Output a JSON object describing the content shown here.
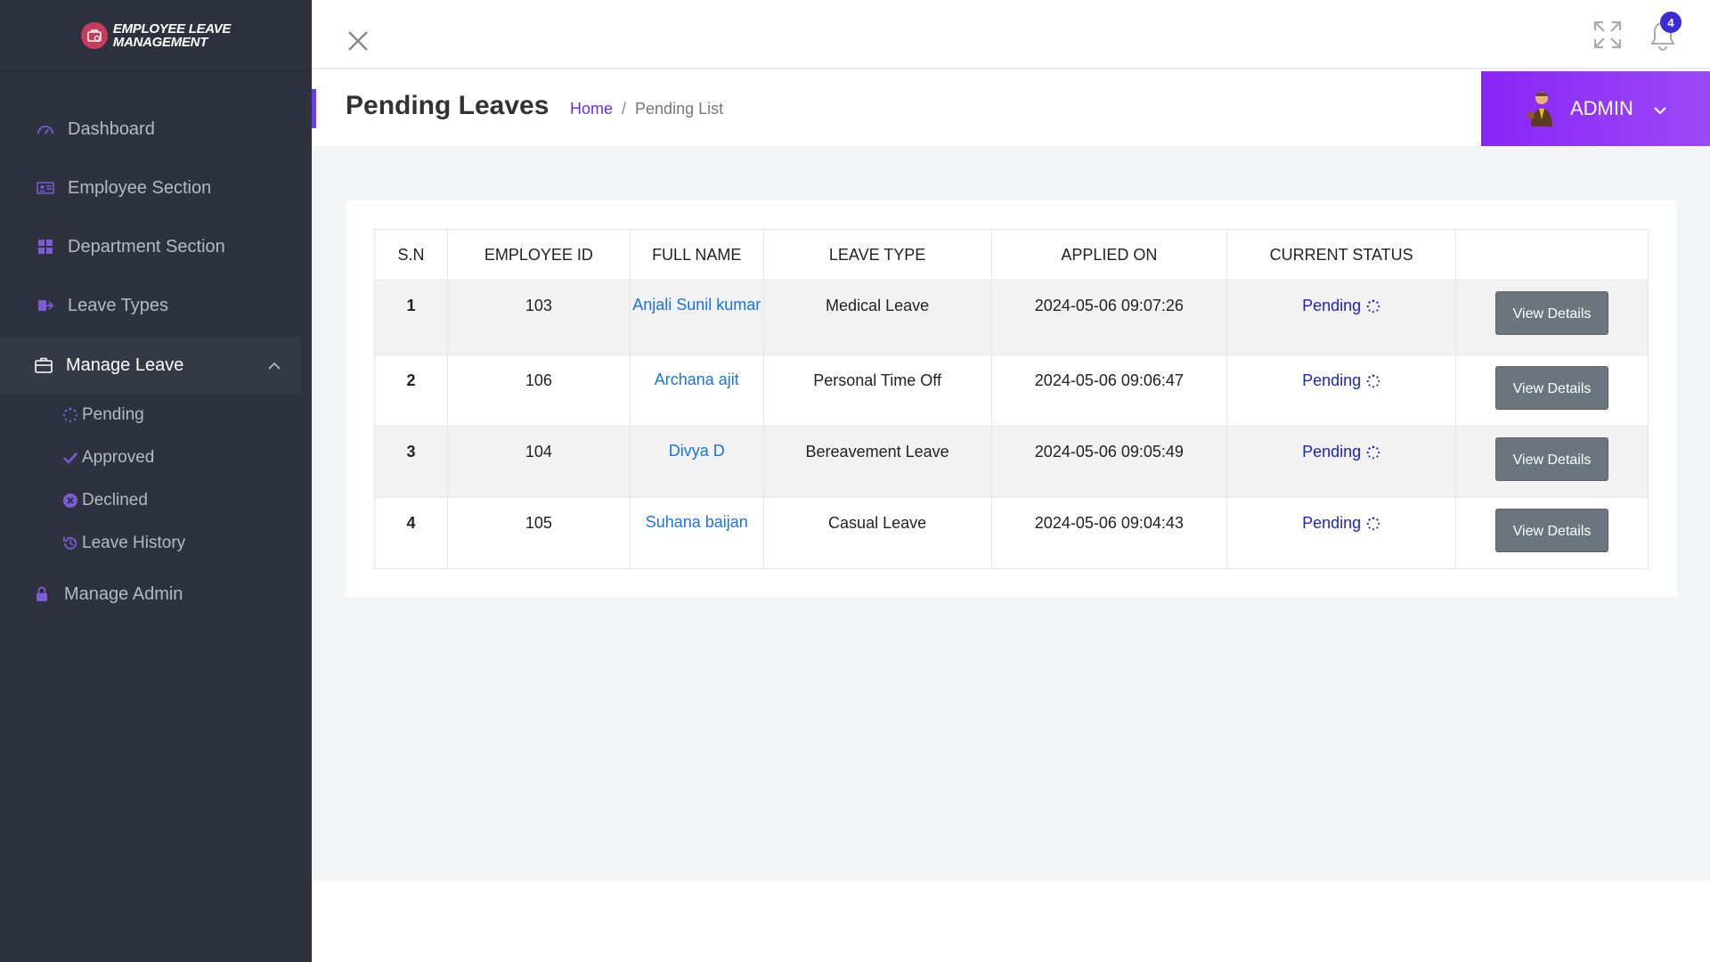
{
  "brand": {
    "line1": "Employee Leave",
    "line2": "Management",
    "logo_icon": "briefcase-icon",
    "logo_color": "#c73b5c"
  },
  "sidebar": {
    "items": [
      {
        "label": "Dashboard",
        "icon": "dashboard-gauge-icon"
      },
      {
        "label": "Employee Section",
        "icon": "id-card-icon"
      },
      {
        "label": "Department Section",
        "icon": "grid-icon"
      },
      {
        "label": "Leave Types",
        "icon": "sign-out-icon"
      },
      {
        "label": "Manage Leave",
        "icon": "briefcase-icon",
        "active": true,
        "expanded": true
      },
      {
        "label": "Manage Admin",
        "icon": "lock-icon"
      }
    ],
    "submenu": [
      {
        "label": "Pending",
        "icon": "spinner-icon"
      },
      {
        "label": "Approved",
        "icon": "check-icon"
      },
      {
        "label": "Declined",
        "icon": "times-circle-icon"
      },
      {
        "label": "Leave History",
        "icon": "history-icon"
      }
    ]
  },
  "topbar": {
    "notification_count": "4"
  },
  "header": {
    "title": "Pending Leaves",
    "breadcrumb_home": "Home",
    "breadcrumb_sep": "/",
    "breadcrumb_current": "Pending List"
  },
  "admin": {
    "label": "ADMIN"
  },
  "table": {
    "columns": [
      "S.N",
      "EMPLOYEE ID",
      "FULL NAME",
      "LEAVE TYPE",
      "APPLIED ON",
      "CURRENT STATUS",
      ""
    ],
    "rows": [
      {
        "sn": "1",
        "emp_id": "103",
        "name": "Anjali Sunil kumar",
        "type": "Medical Leave",
        "applied": "2024-05-06 09:07:26",
        "status": "Pending",
        "action": "View Details"
      },
      {
        "sn": "2",
        "emp_id": "106",
        "name": "Archana ajit",
        "type": "Personal Time Off",
        "applied": "2024-05-06 09:06:47",
        "status": "Pending",
        "action": "View Details"
      },
      {
        "sn": "3",
        "emp_id": "104",
        "name": "Divya D",
        "type": "Bereavement Leave",
        "applied": "2024-05-06 09:05:49",
        "status": "Pending",
        "action": "View Details"
      },
      {
        "sn": "4",
        "emp_id": "105",
        "name": "Suhana baijan",
        "type": "Casual Leave",
        "applied": "2024-05-06 09:04:43",
        "status": "Pending",
        "action": "View Details"
      }
    ]
  },
  "colors": {
    "sidebar_bg": "#2d323e",
    "accent": "#8a25f5",
    "link": "#1a73e8",
    "status": "#1a1fd8"
  }
}
